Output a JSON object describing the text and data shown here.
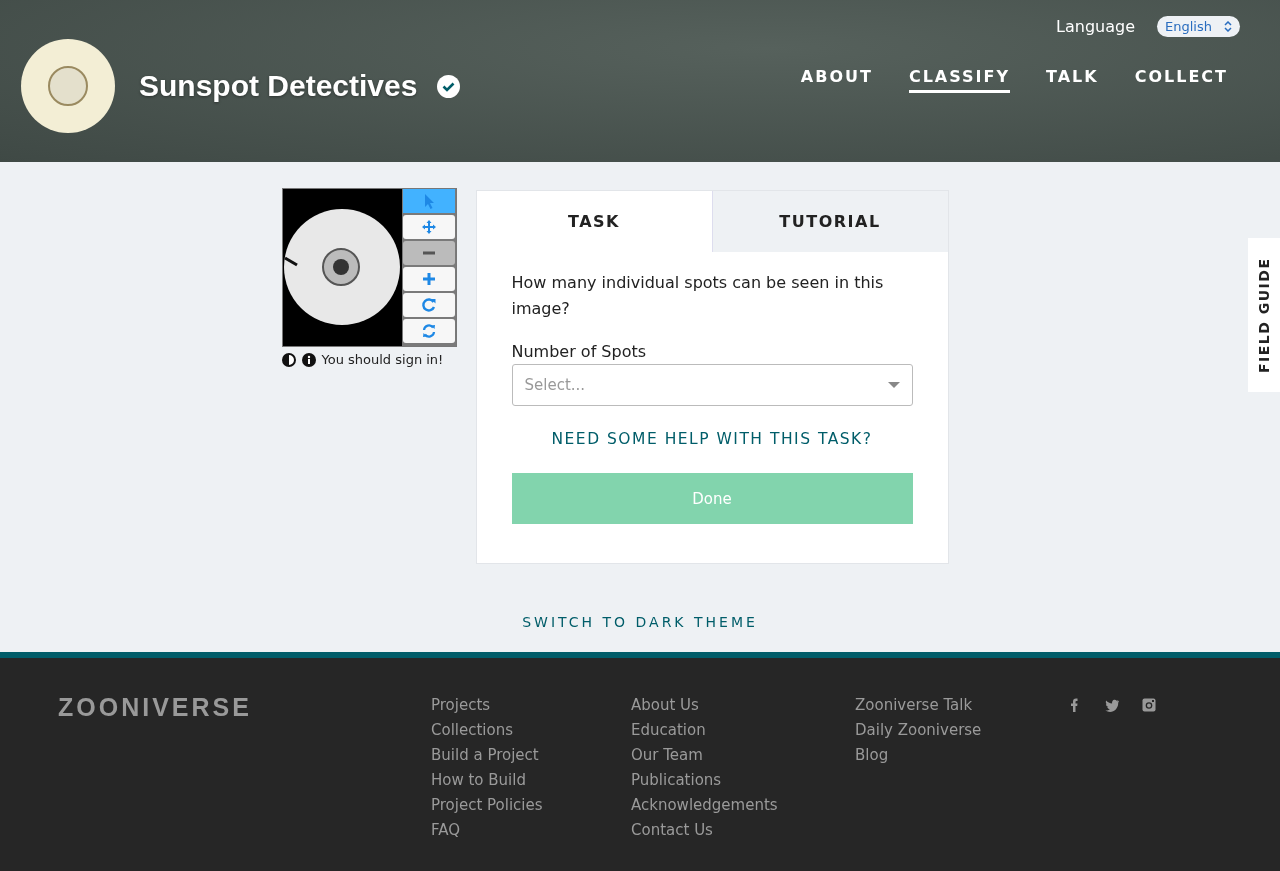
{
  "header": {
    "project_title": "Sunspot Detectives",
    "verified": true,
    "language_label": "Language",
    "language_value": "English",
    "nav": [
      {
        "label": "ABOUT",
        "selected": false
      },
      {
        "label": "CLASSIFY",
        "selected": true
      },
      {
        "label": "TALK",
        "selected": false
      },
      {
        "label": "COLLECT",
        "selected": false
      }
    ]
  },
  "viewer": {
    "tools": [
      {
        "kind": "pointer",
        "selected": true,
        "disabled": false
      },
      {
        "kind": "move",
        "selected": false,
        "disabled": false
      },
      {
        "kind": "zoom-out",
        "selected": false,
        "disabled": true
      },
      {
        "kind": "zoom-in",
        "selected": false,
        "disabled": false
      },
      {
        "kind": "rotate",
        "selected": false,
        "disabled": false
      },
      {
        "kind": "reset",
        "selected": false,
        "disabled": false
      }
    ],
    "message": "You should sign in!"
  },
  "task_panel": {
    "tabs": [
      {
        "label": "TASK",
        "selected": true
      },
      {
        "label": "TUTORIAL",
        "selected": false
      }
    ],
    "question": "How many individual spots can be seen in this image?",
    "field_label": "Number of Spots",
    "placeholder": "Select...",
    "help_link": "NEED SOME HELP WITH THIS TASK?",
    "done_button": {
      "label": "Done",
      "disabled": true
    }
  },
  "field_guide": "FIELD GUIDE",
  "theme_switch": "SWITCH TO DARK THEME",
  "footer": {
    "logo": "ZOONIVERSE",
    "columns": [
      [
        "Projects",
        "Collections",
        "Build a Project",
        "How to Build",
        "Project Policies",
        "FAQ"
      ],
      [
        "About Us",
        "Education",
        "Our Team",
        "Publications",
        "Acknowledgements",
        "Contact Us"
      ],
      [
        "Zooniverse Talk",
        "Daily Zooniverse",
        "Blog"
      ]
    ],
    "social": [
      {
        "kind": "facebook"
      },
      {
        "kind": "twitter"
      },
      {
        "kind": "instagram"
      }
    ]
  }
}
